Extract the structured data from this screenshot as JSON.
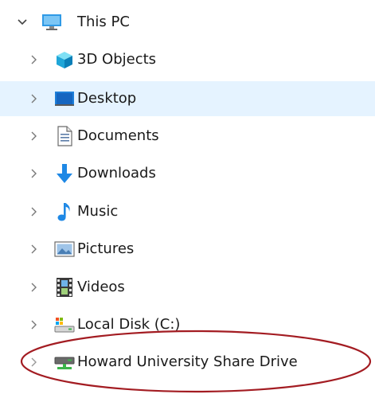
{
  "tree": {
    "root": {
      "label": "This PC",
      "expanded": true,
      "icon": "this-pc-icon"
    },
    "items": [
      {
        "label": "3D Objects",
        "icon": "3d-objects-icon"
      },
      {
        "label": "Desktop",
        "icon": "desktop-icon",
        "selected": true
      },
      {
        "label": "Documents",
        "icon": "documents-icon"
      },
      {
        "label": "Downloads",
        "icon": "downloads-icon"
      },
      {
        "label": "Music",
        "icon": "music-icon"
      },
      {
        "label": "Pictures",
        "icon": "pictures-icon"
      },
      {
        "label": "Videos",
        "icon": "videos-icon"
      },
      {
        "label": "Local Disk (C:)",
        "icon": "local-disk-icon"
      },
      {
        "label": "Howard University Share Drive",
        "icon": "network-drive-icon",
        "highlighted": true
      }
    ]
  },
  "colors": {
    "selection": "#e5f3ff",
    "annotation": "#a31c22"
  }
}
